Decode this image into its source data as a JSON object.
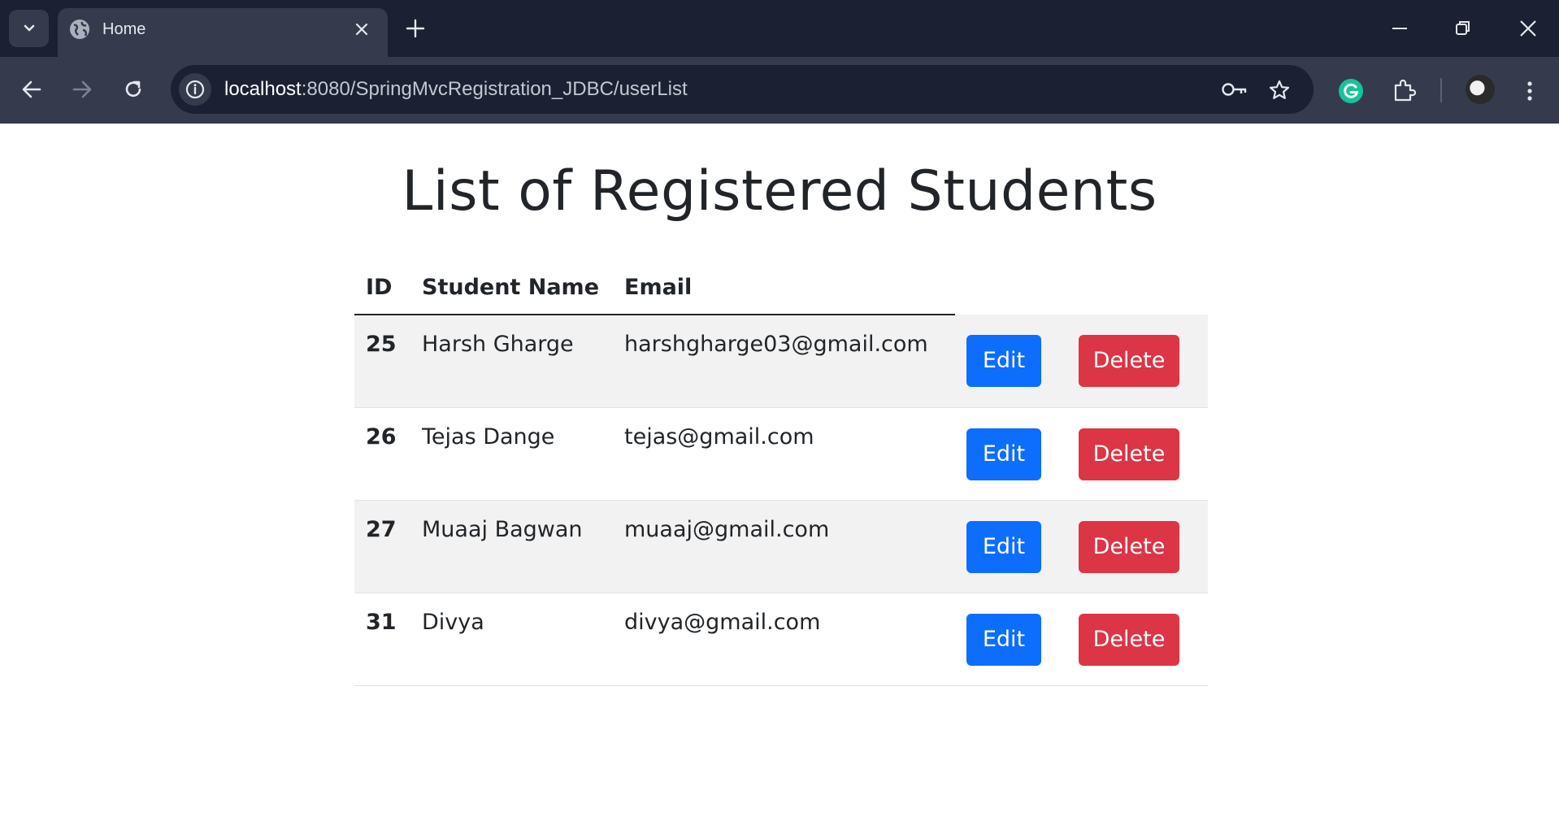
{
  "browser": {
    "tab_title": "Home",
    "url_host": "localhost",
    "url_path": ":8080/SpringMvcRegistration_JDBC/userList"
  },
  "page": {
    "title": "List of Registered Students",
    "columns": {
      "id": "ID",
      "name": "Student Name",
      "email": "Email"
    },
    "rows": [
      {
        "id": "25",
        "name": "Harsh Gharge",
        "email": "harshgharge03@gmail.com"
      },
      {
        "id": "26",
        "name": "Tejas Dange",
        "email": "tejas@gmail.com"
      },
      {
        "id": "27",
        "name": "Muaaj Bagwan",
        "email": "muaaj@gmail.com"
      },
      {
        "id": "31",
        "name": "Divya",
        "email": "divya@gmail.com"
      }
    ],
    "edit_label": "Edit",
    "delete_label": "Delete"
  },
  "colors": {
    "edit_button": "#0d6efd",
    "delete_button": "#dc3545",
    "chrome_dark": "#1b2133",
    "chrome_toolbar": "#353b4c"
  },
  "icons": [
    "chevron-down-icon",
    "globe-icon",
    "close-icon",
    "plus-icon",
    "minimize-icon",
    "restore-icon",
    "window-close-icon",
    "back-arrow-icon",
    "forward-arrow-icon",
    "reload-icon",
    "info-icon",
    "key-icon",
    "star-icon",
    "grammarly-icon",
    "extensions-icon",
    "menu-dots-icon"
  ]
}
